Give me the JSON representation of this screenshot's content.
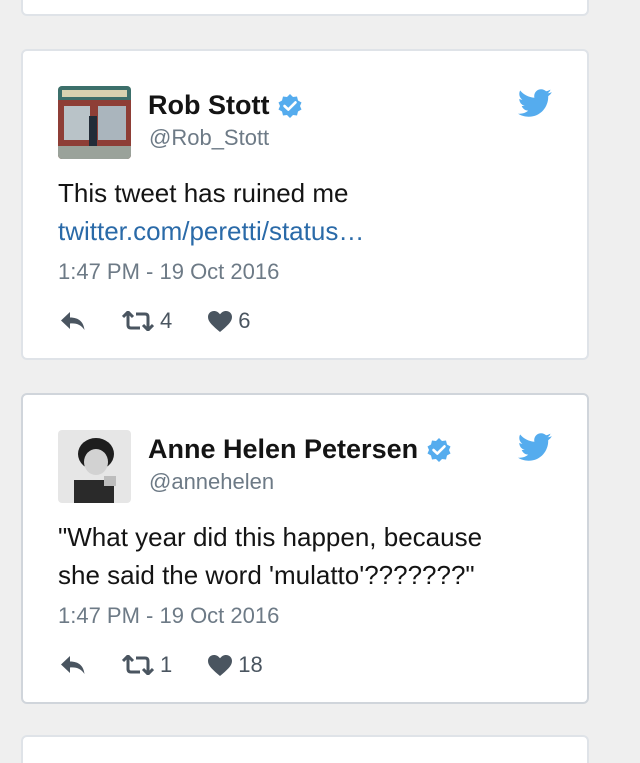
{
  "colors": {
    "background": "#efefef",
    "card": "#ffffff",
    "border": "#dfe3e8",
    "text": "#141414",
    "secondary": "#6d7a86",
    "link": "#2a6aa8",
    "twitter_blue": "#55acee",
    "action": "#4a5560"
  },
  "tweets": [
    {
      "name": "Rob Stott",
      "handle": "@Rob_Stott",
      "verified": true,
      "text_lines": [
        "This tweet has ruined me"
      ],
      "link": "twitter.com/peretti/status…",
      "timestamp": "1:47 PM - 19 Oct 2016",
      "retweets": "4",
      "likes": "6",
      "avatar_icon": "storefront-photo"
    },
    {
      "name": "Anne Helen Petersen",
      "handle": "@annehelen",
      "verified": true,
      "text_lines": [
        "\"What year did this happen, because",
        "she said the word 'mulatto'???????\""
      ],
      "timestamp": "1:47 PM - 19 Oct 2016",
      "retweets": "1",
      "likes": "18",
      "avatar_icon": "black-and-white-portrait-photo"
    }
  ]
}
